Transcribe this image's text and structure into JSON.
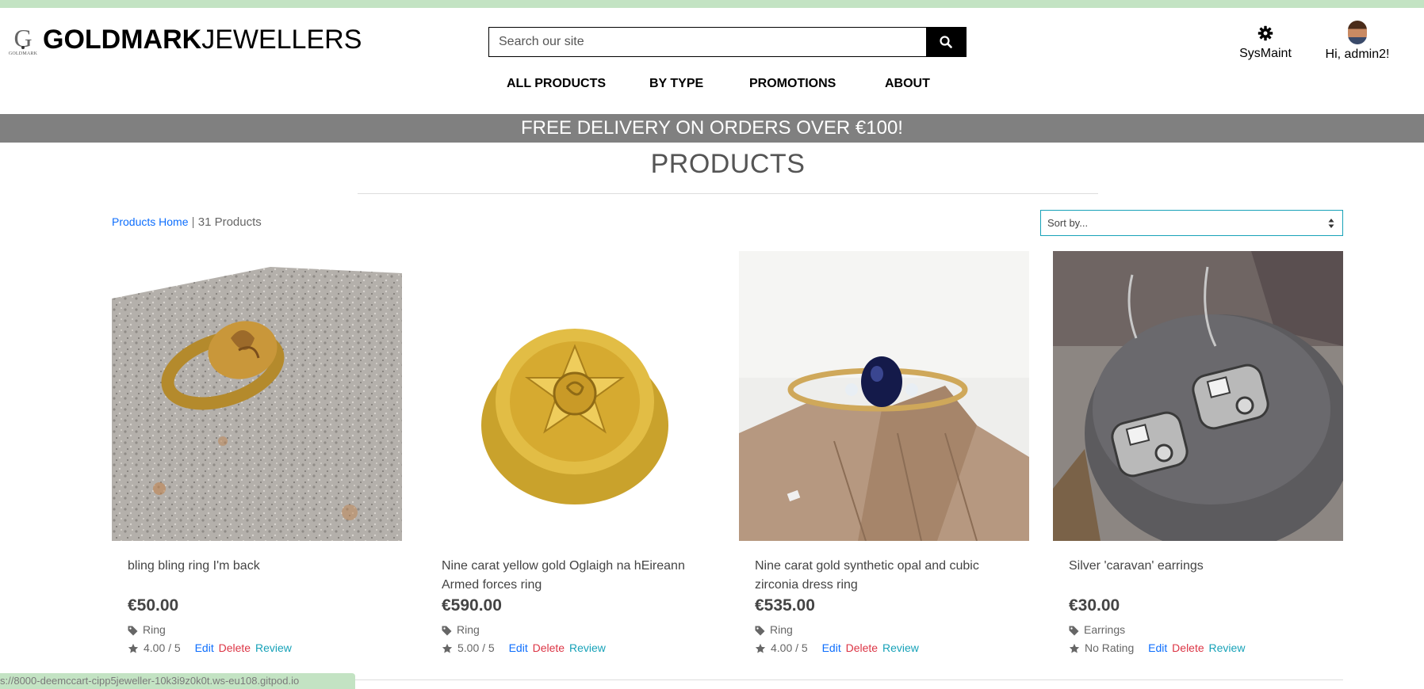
{
  "header": {
    "logo_letter": "G",
    "logo_small": "GOLDMARK",
    "brand_bold": "GOLDMARK",
    "brand_light": "JEWELLERS",
    "search_placeholder": "Search our site",
    "sysmaint_label": "SysMaint",
    "user_label": "Hi, admin2!"
  },
  "nav": {
    "items": [
      "ALL PRODUCTS",
      "BY TYPE",
      "PROMOTIONS",
      "ABOUT"
    ]
  },
  "banner": {
    "text": "FREE DELIVERY ON ORDERS OVER €100!"
  },
  "page": {
    "title": "PRODUCTS",
    "breadcrumb_link": "Products Home",
    "breadcrumb_sep": "|",
    "count": "31 Products",
    "sort_label": "Sort by..."
  },
  "products": [
    {
      "name": "bling bling ring I'm back",
      "price": "€50.00",
      "category": "Ring",
      "rating": "4.00 / 5",
      "edit": "Edit",
      "delete": "Delete",
      "review": "Review"
    },
    {
      "name": "Nine carat yellow gold Oglaigh na hEireann Armed forces ring",
      "price": "€590.00",
      "category": "Ring",
      "rating": "5.00 / 5",
      "edit": "Edit",
      "delete": "Delete",
      "review": "Review"
    },
    {
      "name": "Nine carat gold synthetic opal and cubic zirconia dress ring",
      "price": "€535.00",
      "category": "Ring",
      "rating": "4.00 / 5",
      "edit": "Edit",
      "delete": "Delete",
      "review": "Review"
    },
    {
      "name": "Silver 'caravan' earrings",
      "price": "€30.00",
      "category": "Earrings",
      "rating": "No Rating",
      "edit": "Edit",
      "delete": "Delete",
      "review": "Review"
    }
  ],
  "status_bar": {
    "url": "s://8000-deemccart-cipp5jeweller-10k3i9z0k0t.ws-eu108.gitpod.io"
  },
  "colors": {
    "banner": "#808080",
    "topline": "#c3e3c3",
    "link": "#0d6efd",
    "delete": "#dc3545",
    "review": "#17a2b8"
  },
  "icons": [
    "search-icon",
    "gear-icon",
    "avatar",
    "tag-icon",
    "star-icon",
    "sort-arrows-icon"
  ]
}
